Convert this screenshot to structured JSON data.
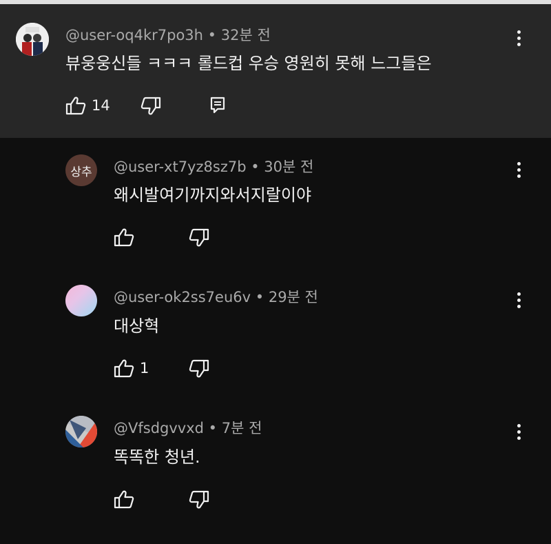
{
  "comments": [
    {
      "handle": "@user-oq4kr7po3h",
      "time": "32분 전",
      "text": "뷰웅웅신들 ㅋㅋㅋ 롤드컵 우승 영원히 못해 느그들은",
      "likes": "14",
      "avatar": "photo"
    },
    {
      "handle": "@user-xt7yz8sz7b",
      "time": "30분 전",
      "text": "왜시발여기까지와서지랄이야",
      "likes": "",
      "avatar_text": "상추",
      "avatar_color": "#5a3a32"
    },
    {
      "handle": "@user-ok2ss7eu6v",
      "time": "29분 전",
      "text": "대상혁",
      "likes": "1",
      "avatar": "pastel-gradient"
    },
    {
      "handle": "@Vfsdgvvxd",
      "time": "7분 전",
      "text": "똑똑한 청년.",
      "likes": "",
      "avatar": "red-blue"
    }
  ],
  "separator": "•",
  "colors": {
    "background": "#0f0f0f",
    "highlight": "#272727",
    "meta_text": "#aaaaaa",
    "text": "#f1f1f1"
  }
}
